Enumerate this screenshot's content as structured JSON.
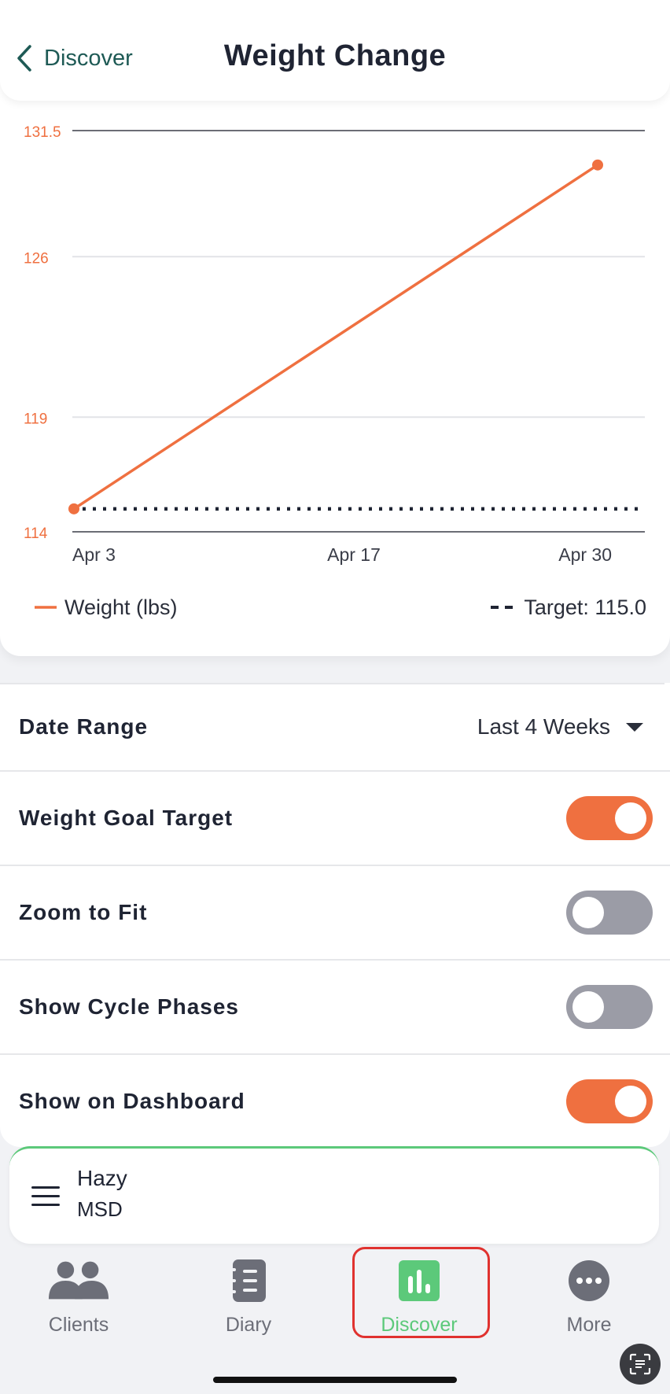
{
  "header": {
    "back_label": "Discover",
    "title": "Weight Change"
  },
  "legend": {
    "weight_label": "Weight (lbs)",
    "target_label": "Target: 115.0"
  },
  "chart_data": {
    "type": "line",
    "ylim": [
      114,
      131.5
    ],
    "yticks": [
      "131.5",
      "126",
      "119",
      "114"
    ],
    "xticks": [
      "Apr 3",
      "Apr 17",
      "Apr 30"
    ],
    "series": [
      {
        "name": "Weight (lbs)",
        "x": [
          "Apr 3",
          "Apr 30"
        ],
        "values": [
          115.0,
          130.0
        ],
        "color": "#ef7040"
      }
    ],
    "target": {
      "label": "Target: 115.0",
      "value": 115.0,
      "style": "dotted",
      "color": "#1f2433"
    },
    "grid": true
  },
  "settings": {
    "date_range_label": "Date Range",
    "date_range_value": "Last 4 Weeks",
    "rows": [
      {
        "label": "Weight Goal Target",
        "on": true
      },
      {
        "label": "Zoom to Fit",
        "on": false
      },
      {
        "label": "Show Cycle Phases",
        "on": false
      },
      {
        "label": "Show on Dashboard",
        "on": true
      }
    ]
  },
  "client": {
    "name": "Hazy",
    "sub": "MSD"
  },
  "tabs": [
    {
      "label": "Clients",
      "icon": "people-icon",
      "active": false
    },
    {
      "label": "Diary",
      "icon": "notebook-icon",
      "active": false
    },
    {
      "label": "Discover",
      "icon": "bar-chart-icon",
      "active": true
    },
    {
      "label": "More",
      "icon": "more-icon",
      "active": false
    }
  ],
  "colors": {
    "accent": "#ef7040",
    "brand_green": "#5cc97a",
    "back_teal": "#1e5a55"
  }
}
